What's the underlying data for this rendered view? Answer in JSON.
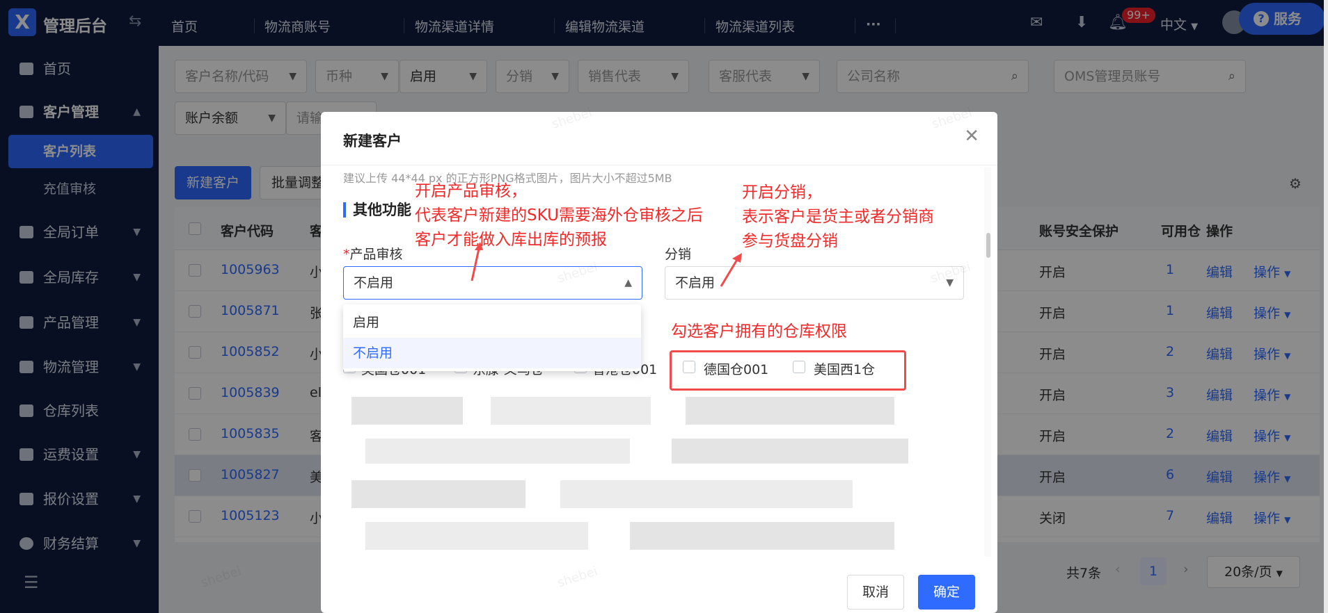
{
  "topbar": {
    "logo_glyph": "X",
    "brand": "管理后台",
    "collapse_glyph": "⇆",
    "tabs": [
      "首页",
      "物流商账号",
      "物流渠道详情",
      "编辑物流渠道",
      "物流渠道列表"
    ],
    "more": "···",
    "badge": "99+",
    "lang": "中文",
    "service": "服务"
  },
  "sidebar": {
    "items": [
      {
        "label": "首页"
      },
      {
        "label": "客户管理"
      },
      {
        "label": "全局订单"
      },
      {
        "label": "全局库存"
      },
      {
        "label": "产品管理"
      },
      {
        "label": "物流管理"
      },
      {
        "label": "仓库列表"
      },
      {
        "label": "运费设置"
      },
      {
        "label": "报价设置"
      },
      {
        "label": "财务结算"
      }
    ],
    "sub_items": [
      {
        "label": "客户列表"
      },
      {
        "label": "充值审核"
      }
    ]
  },
  "filters": {
    "customer_name": "客户名称/代码",
    "currency": "币种",
    "status": "启用",
    "distribution": "分销",
    "sales_rep": "销售代表",
    "cs_rep": "客服代表",
    "company": "公司名称",
    "oms_account": "OMS管理员账号",
    "balance": "账户余额",
    "balance_input": "请输"
  },
  "toolbar": {
    "new_customer": "新建客户",
    "batch_adjust": "批量调整"
  },
  "table": {
    "headers": {
      "code": "客户代码",
      "name": "客",
      "security": "账号安全保护",
      "available": "可用仓",
      "action": "操作"
    },
    "rows": [
      {
        "code": "1005963",
        "name": "小",
        "security": "开启",
        "available": "1",
        "edit": "编辑",
        "op": "操作"
      },
      {
        "code": "1005871",
        "name": "张",
        "security": "开启",
        "available": "1",
        "edit": "编辑",
        "op": "操作"
      },
      {
        "code": "1005852",
        "name": "小",
        "security": "开启",
        "available": "2",
        "edit": "编辑",
        "op": "操作"
      },
      {
        "code": "1005839",
        "name": "ell",
        "security": "开启",
        "available": "3",
        "edit": "编辑",
        "op": "操作"
      },
      {
        "code": "1005835",
        "name": "客",
        "security": "开启",
        "available": "2",
        "edit": "编辑",
        "op": "操作"
      },
      {
        "code": "1005827",
        "name": "美",
        "security": "开启",
        "available": "6",
        "edit": "编辑",
        "op": "操作"
      },
      {
        "code": "1005123",
        "name": "小",
        "security": "关闭",
        "available": "7",
        "edit": "编辑",
        "op": "操作"
      }
    ]
  },
  "pagination": {
    "total": "共7条",
    "page": "1",
    "page_size": "20条/页"
  },
  "modal": {
    "title": "新建客户",
    "hint": "建议上传 44*44 px 的正方形PNG格式图片，图片大小不超过5MB",
    "section": "其他功能",
    "product_review_label": "产品审核",
    "product_review_value": "不启用",
    "distribution_label": "分销",
    "distribution_value": "不启用",
    "dropdown_options": [
      "启用",
      "不启用"
    ],
    "warehouses_hidden": [
      "英国仓001",
      "东滕-义乌仓",
      "香港仓001"
    ],
    "warehouses": [
      "德国仓001",
      "美国西1仓"
    ],
    "cancel": "取消",
    "confirm": "确定"
  },
  "annotations": {
    "product_review": [
      "开启产品审核，",
      "代表客户新建的SKU需要海外仓审核之后",
      "客户才能做入库出库的预报"
    ],
    "distribution": [
      "开启分销，",
      "表示客户是货主或者分销商",
      "参与货盘分销"
    ],
    "warehouse": "勾选客户拥有的仓库权限"
  },
  "watermark": "shebei"
}
